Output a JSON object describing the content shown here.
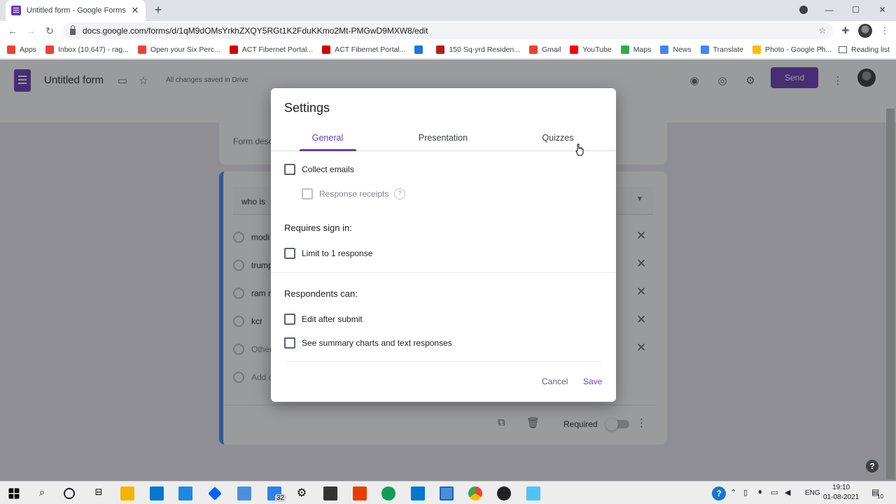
{
  "browser": {
    "tab_title": "Untitled form - Google Forms",
    "tab_close": "✕",
    "new_tab": "+",
    "url": "docs.google.com/forms/d/1qM9dOMsYrkhZXQY5RGt1K2FduKKmo2Mt-PMGwD9MXW8/edit",
    "minimize": "—",
    "maximize": "☐",
    "close": "✕"
  },
  "bookmarks": [
    {
      "label": "Apps",
      "icon": "apps-grid-icon",
      "color": "#ea4335"
    },
    {
      "label": "Inbox (10,647) - rag...",
      "icon": "gmail-icon",
      "color": "#ea4335"
    },
    {
      "label": "Open your Six Perc...",
      "icon": "gmail-icon",
      "color": "#ea4335"
    },
    {
      "label": "ACT Fibernet Portal...",
      "icon": "act-icon",
      "color": "#d50000"
    },
    {
      "label": "ACT Fibernet Portal...",
      "icon": "act-icon",
      "color": "#d50000"
    },
    {
      "label": "",
      "icon": "history-icon",
      "color": "#1a73e8"
    },
    {
      "label": "150 Sq-yrd Residen...",
      "icon": "site-icon",
      "color": "#b71c1c"
    },
    {
      "label": "Gmail",
      "icon": "gmail-icon",
      "color": "#ea4335"
    },
    {
      "label": "YouTube",
      "icon": "youtube-icon",
      "color": "#ff0000"
    },
    {
      "label": "Maps",
      "icon": "maps-icon",
      "color": "#34a853"
    },
    {
      "label": "News",
      "icon": "news-icon",
      "color": "#4285f4"
    },
    {
      "label": "Translate",
      "icon": "translate-icon",
      "color": "#4285f4"
    },
    {
      "label": "Photo - Google Ph...",
      "icon": "photos-icon",
      "color": "#fbbc04"
    }
  ],
  "bookmarks_more": "»",
  "reading_list": "Reading list",
  "form": {
    "title": "Untitled form",
    "saved_status": "All changes saved in Drive",
    "send_label": "Send",
    "description_placeholder": "Form desc",
    "question_text": "who is",
    "options": [
      "modi",
      "trump",
      "ram n",
      "kcr",
      "Other"
    ],
    "add_option": "Add o",
    "required_label": "Required"
  },
  "settings_dialog": {
    "title": "Settings",
    "tabs": [
      "General",
      "Presentation",
      "Quizzes"
    ],
    "active_tab": "General",
    "collect_emails": "Collect emails",
    "response_receipts": "Response receipts",
    "requires_sign_in": "Requires sign in:",
    "limit_one": "Limit to 1 response",
    "respondents_can": "Respondents can:",
    "edit_after_submit": "Edit after submit",
    "see_summary": "See summary charts and text responses",
    "cancel": "Cancel",
    "save": "Save"
  },
  "taskbar": {
    "badge_count": "32",
    "language": "ENG",
    "time": "19:10",
    "date": "01-08-2021",
    "notification_count": "10"
  },
  "colors": {
    "accent": "#673ab7",
    "question_border": "#4285f4"
  }
}
